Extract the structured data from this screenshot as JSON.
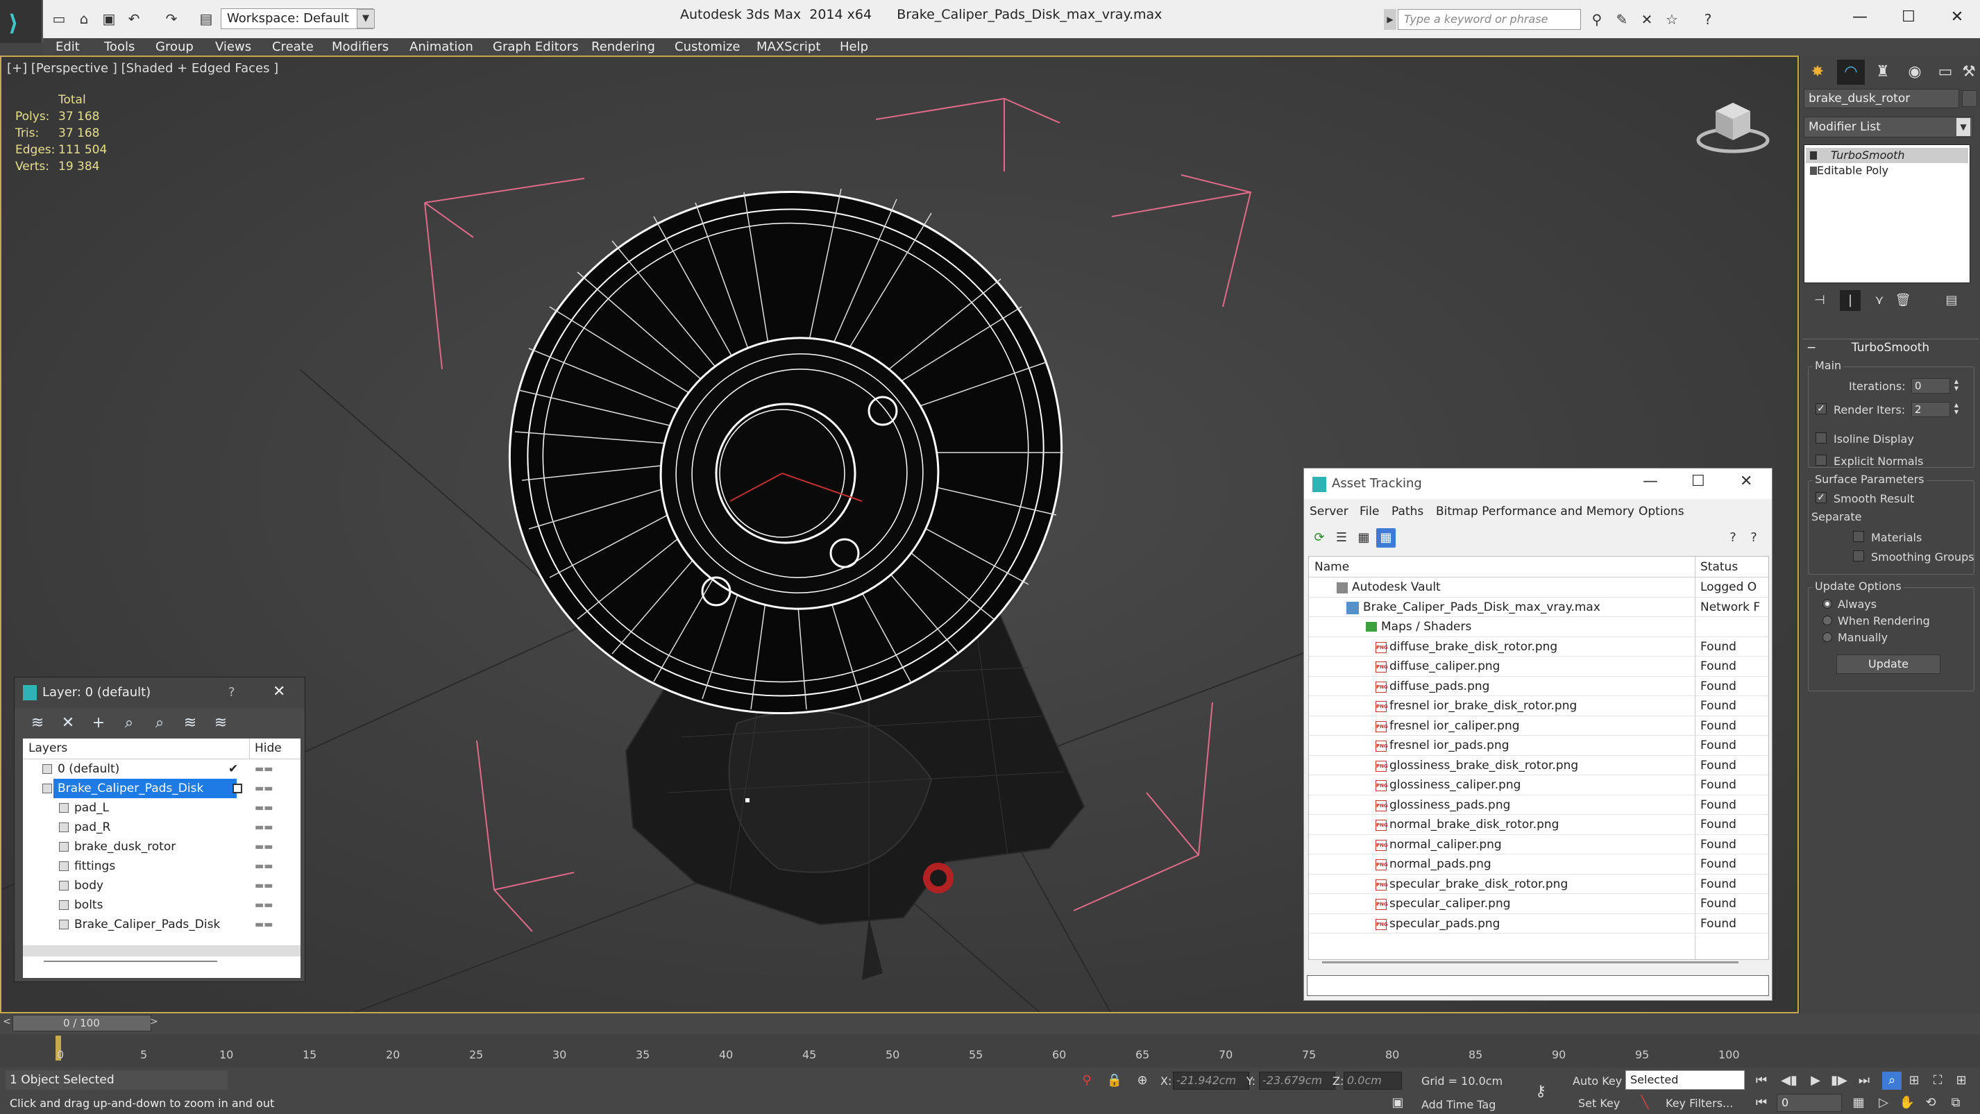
{
  "titlebar": {
    "workspace": "Workspace: Default",
    "title": "Autodesk 3ds Max  2014 x64      Brake_Caliper_Pads_Disk_max_vray.max",
    "search_placeholder": "Type a keyword or phrase"
  },
  "menu": [
    "Edit",
    "Tools",
    "Group",
    "Views",
    "Create",
    "Modifiers",
    "Animation",
    "Graph Editors",
    "Rendering",
    "Customize",
    "MAXScript",
    "Help"
  ],
  "viewport": {
    "label": "[+] [Perspective ] [Shaded + Edged Faces ]",
    "stats_header": "Total",
    "stats": [
      {
        "k": "Polys:",
        "v": "37 168"
      },
      {
        "k": "Tris:",
        "v": "37 168"
      },
      {
        "k": "Edges:",
        "v": "111 504"
      },
      {
        "k": "Verts:",
        "v": "19 384"
      }
    ],
    "stats_color": "#e7e08a",
    "border_color": "#c8a94b"
  },
  "layer_panel": {
    "title": "Layer: 0 (default)",
    "help": "?",
    "col_layers": "Layers",
    "col_hide": "Hide",
    "rows": [
      {
        "label": "0 (default)"
      },
      {
        "label": "Brake_Caliper_Pads_Disk"
      },
      {
        "label": "pad_L"
      },
      {
        "label": "pad_R"
      },
      {
        "label": "brake_dusk_rotor"
      },
      {
        "label": "fittings"
      },
      {
        "label": "body"
      },
      {
        "label": "bolts"
      },
      {
        "label": "Brake_Caliper_Pads_Disk"
      }
    ]
  },
  "asset_panel": {
    "title": "Asset Tracking",
    "menu": [
      "Server",
      "File",
      "Paths",
      "Bitmap Performance and Memory",
      "Options"
    ],
    "col_name": "Name",
    "col_status": "Status",
    "rows": [
      {
        "name": "Autodesk Vault",
        "status": "Logged O"
      },
      {
        "name": "Brake_Caliper_Pads_Disk_max_vray.max",
        "status": "Network F"
      },
      {
        "name": "Maps / Shaders",
        "status": ""
      },
      {
        "name": "diffuse_brake_disk_rotor.png",
        "status": "Found"
      },
      {
        "name": "diffuse_caliper.png",
        "status": "Found"
      },
      {
        "name": "diffuse_pads.png",
        "status": "Found"
      },
      {
        "name": "fresnel ior_brake_disk_rotor.png",
        "status": "Found"
      },
      {
        "name": "fresnel ior_caliper.png",
        "status": "Found"
      },
      {
        "name": "fresnel ior_pads.png",
        "status": "Found"
      },
      {
        "name": "glossiness_brake_disk_rotor.png",
        "status": "Found"
      },
      {
        "name": "glossiness_caliper.png",
        "status": "Found"
      },
      {
        "name": "glossiness_pads.png",
        "status": "Found"
      },
      {
        "name": "normal_brake_disk_rotor.png",
        "status": "Found"
      },
      {
        "name": "normal_caliper.png",
        "status": "Found"
      },
      {
        "name": "normal_pads.png",
        "status": "Found"
      },
      {
        "name": "specular_brake_disk_rotor.png",
        "status": "Found"
      },
      {
        "name": "specular_caliper.png",
        "status": "Found"
      },
      {
        "name": "specular_pads.png",
        "status": "Found"
      }
    ]
  },
  "command_panel": {
    "object_name": "brake_dusk_rotor",
    "modifier_list": "Modifier List",
    "stack": [
      "TurboSmooth",
      "Editable Poly"
    ],
    "rollout_title": "TurboSmooth",
    "main_group": "Main",
    "iterations_label": "Iterations:",
    "iterations_value": "0",
    "render_iters_label": "Render Iters:",
    "render_iters_value": "2",
    "isoline_label": "Isoline Display",
    "explicit_label": "Explicit Normals",
    "surface_group": "Surface Parameters",
    "smooth_result_label": "Smooth Result",
    "separate_label": "Separate",
    "materials_label": "Materials",
    "smoothing_groups_label": "Smoothing Groups",
    "update_group": "Update Options",
    "always_label": "Always",
    "when_rendering_label": "When Rendering",
    "manually_label": "Manually",
    "update_button": "Update"
  },
  "timeline": {
    "slider": "0 / 100",
    "ticks": [
      "0",
      "5",
      "10",
      "15",
      "20",
      "25",
      "30",
      "35",
      "40",
      "45",
      "50",
      "55",
      "60",
      "65",
      "70",
      "75",
      "80",
      "85",
      "90",
      "95",
      "100"
    ]
  },
  "status": {
    "selection": "1 Object Selected",
    "prompt": "Click and drag up-and-down to zoom in and out",
    "x_label": "X:",
    "x_value": "-21.942cm",
    "y_label": "Y:",
    "y_value": "-23.679cm",
    "z_label": "Z:",
    "z_value": "0.0cm",
    "grid": "Grid = 10.0cm",
    "add_time_tag": "Add Time Tag",
    "auto_key": "Auto Key",
    "selected": "Selected",
    "set_key": "Set Key",
    "key_filters": "Key Filters...",
    "frame": "0"
  }
}
